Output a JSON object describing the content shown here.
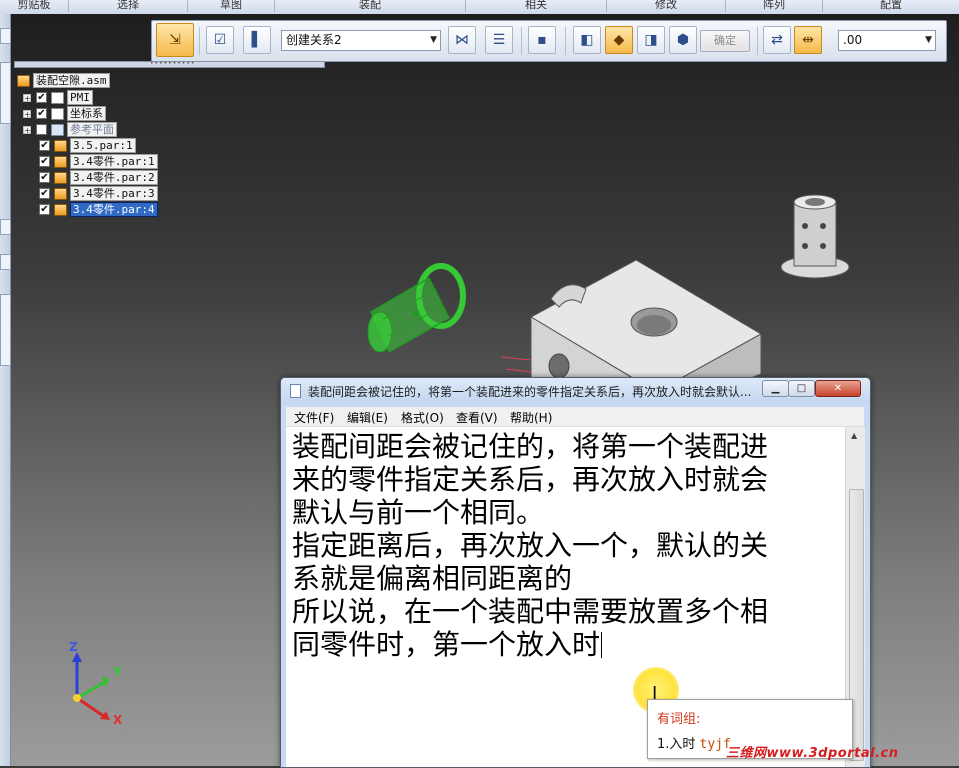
{
  "ribbon": {
    "groups": [
      "剪贴板",
      "选择",
      "草图",
      "装配",
      "相关",
      "修改",
      "阵列",
      "配置"
    ]
  },
  "command_bar": {
    "relationship_select": "创建关系2",
    "confirm_label": "确定",
    "offset_value": ".00"
  },
  "tree": {
    "root": "装配空隙.asm",
    "items": [
      {
        "label": "PMI",
        "checked": true
      },
      {
        "label": "坐标系",
        "checked": true
      },
      {
        "label": "参考平面",
        "checked": false
      },
      {
        "label": "3.5.par:1",
        "checked": true
      },
      {
        "label": "3.4零件.par:1",
        "checked": true
      },
      {
        "label": "3.4零件.par:2",
        "checked": true
      },
      {
        "label": "3.4零件.par:3",
        "checked": true
      },
      {
        "label": "3.4零件.par:4",
        "checked": true
      }
    ]
  },
  "notepad": {
    "title": "装配间距会被记住的，将第一个装配进来的零件指定关系后，再次放入时就会默认...",
    "menus": [
      "文件(F)",
      "编辑(E)",
      "格式(O)",
      "查看(V)",
      "帮助(H)"
    ],
    "lines": [
      "装配间距会被记住的，将第一个装配进",
      "来的零件指定关系后，再次放入时就会",
      "默认与前一个相同。",
      "",
      "指定距离后，再次放入一个，默认的关",
      "系就是偏离相同距离的",
      "所以说，在一个装配中需要放置多个相",
      "同零件时，第一个放入时"
    ]
  },
  "ime": {
    "header": "有词组:",
    "candidate": "1.入时",
    "code": "tyjf"
  },
  "axes": {
    "x": "X",
    "y": "Y",
    "z": "Z"
  },
  "watermark": "三维网www.3dportal.cn",
  "colors": {
    "selection": "#316ac5",
    "active_tool": "#f6b94a",
    "part_green": "#3ad23a"
  }
}
